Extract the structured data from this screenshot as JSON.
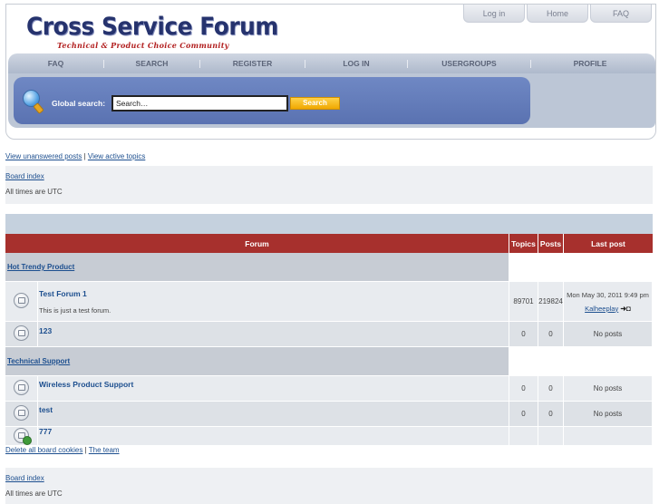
{
  "header": {
    "logo_title": "Cross Service Forum",
    "logo_subtitle": "Technical & Product Choice Community",
    "top_links": [
      "Log in",
      "Home",
      "FAQ"
    ]
  },
  "navbar": {
    "items": [
      "FAQ",
      "SEARCH",
      "REGISTER",
      "LOG IN",
      "USERGROUPS",
      "PROFILE"
    ]
  },
  "search": {
    "label": "Global search:",
    "placeholder": "Search…",
    "value": "Search…",
    "button": "Search"
  },
  "quick_links": {
    "unanswered": "View unanswered posts",
    "separator": " | ",
    "active": "View active topics"
  },
  "breadcrumb": {
    "board_index": "Board index",
    "timezone": "All times are UTC"
  },
  "table": {
    "headers": {
      "forum": "Forum",
      "topics": "Topics",
      "posts": "Posts",
      "last_post": "Last post"
    },
    "categories": [
      {
        "name": "Hot Trendy Product",
        "forums": [
          {
            "title": "Test Forum 1",
            "description": "This is just a test forum.",
            "topics": "89701",
            "posts": "219824",
            "last_date": "Mon May 30, 2011 9:49 pm",
            "last_by": "Kalheeplay",
            "goto": "➜◘"
          },
          {
            "title": "123",
            "description": "",
            "topics": "0",
            "posts": "0",
            "last_date": "No posts",
            "last_by": ""
          }
        ]
      },
      {
        "name": "Technical Support",
        "forums": [
          {
            "title": "Wireless Product Support",
            "description": "",
            "topics": "0",
            "posts": "0",
            "last_date": "No posts",
            "last_by": ""
          },
          {
            "title": "test",
            "description": "",
            "topics": "0",
            "posts": "0",
            "last_date": "No posts",
            "last_by": ""
          },
          {
            "title": "777",
            "description": "",
            "topics": "",
            "posts": "",
            "last_date": "",
            "last_by": ""
          }
        ]
      }
    ]
  },
  "footer": {
    "delete_cookies": "Delete all board cookies",
    "separator": " | ",
    "team": "The team",
    "board_index": "Board index",
    "timezone": "All times are UTC"
  },
  "colors": {
    "header_red": "#a7302d",
    "logo_blue": "#26336e",
    "search_blue": "#5a72b1",
    "search_button": "#f0a800",
    "link": "#1d4f8f"
  }
}
